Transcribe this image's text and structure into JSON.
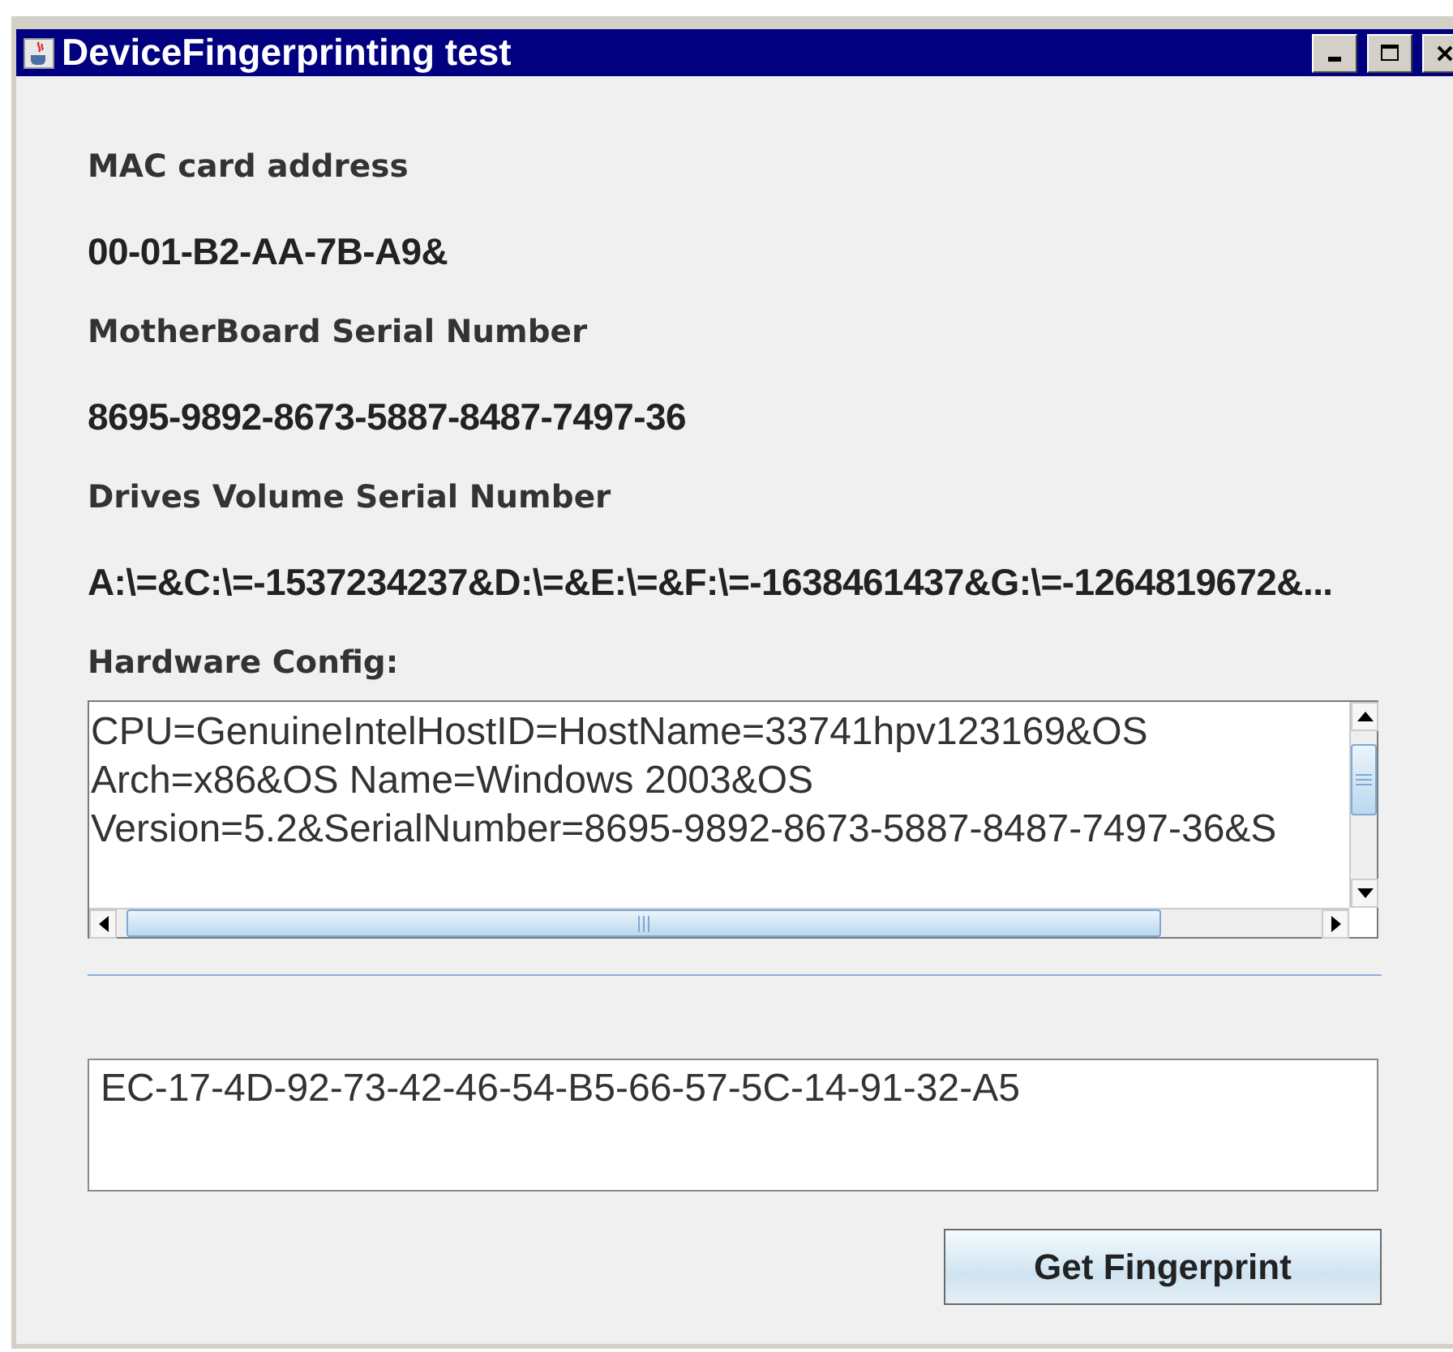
{
  "window": {
    "title": "DeviceFingerprinting test"
  },
  "fields": [
    {
      "label": "MAC card address",
      "value": "00-01-B2-AA-7B-A9&"
    },
    {
      "label": "MotherBoard Serial Number",
      "value": "8695-9892-8673-5887-8487-7497-36"
    },
    {
      "label": "Drives Volume Serial Number",
      "value": "A:\\=&C:\\=-1537234237&D:\\=&E:\\=&F:\\=-1638461437&G:\\=-1264819672&..."
    }
  ],
  "hardware_config": {
    "label": "Hardware Config:",
    "lines": [
      "CPU=GenuineIntelHostID=HostName=33741hpv123169&OS",
      "Arch=x86&OS Name=Windows 2003&OS",
      "Version=5.2&SerialNumber=8695-9892-8673-5887-8487-7497-36&S"
    ]
  },
  "fingerprint": {
    "value": "EC-17-4D-92-73-42-46-54-B5-66-57-5C-14-91-32-A5"
  },
  "buttons": [
    {
      "label": "Get Fingerprint"
    }
  ]
}
